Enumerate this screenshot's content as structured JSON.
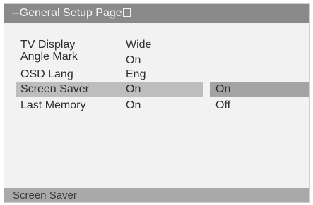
{
  "title_bar": {
    "title": "--General Setup Page"
  },
  "menu": {
    "items": [
      {
        "label": "TV Display",
        "value": "Wide"
      },
      {
        "label": "Angle Mark",
        "value": "On"
      },
      {
        "label": "OSD Lang",
        "value": "Eng"
      },
      {
        "label": "Screen Saver",
        "value": "On"
      },
      {
        "label": "Last Memory",
        "value": "On"
      }
    ],
    "selected_index": 3
  },
  "submenu": {
    "options": [
      "On",
      "Off"
    ],
    "selected_index": 0
  },
  "status_bar": {
    "text": "Screen Saver"
  },
  "colors": {
    "title_bar_bg": "#8a8a8a",
    "screen_bg": "#f2f2f2",
    "selected_row_bg": "#bdbdbd",
    "selected_option_bg": "#a3a3a3",
    "status_bar_bg": "#a9a9a9"
  }
}
